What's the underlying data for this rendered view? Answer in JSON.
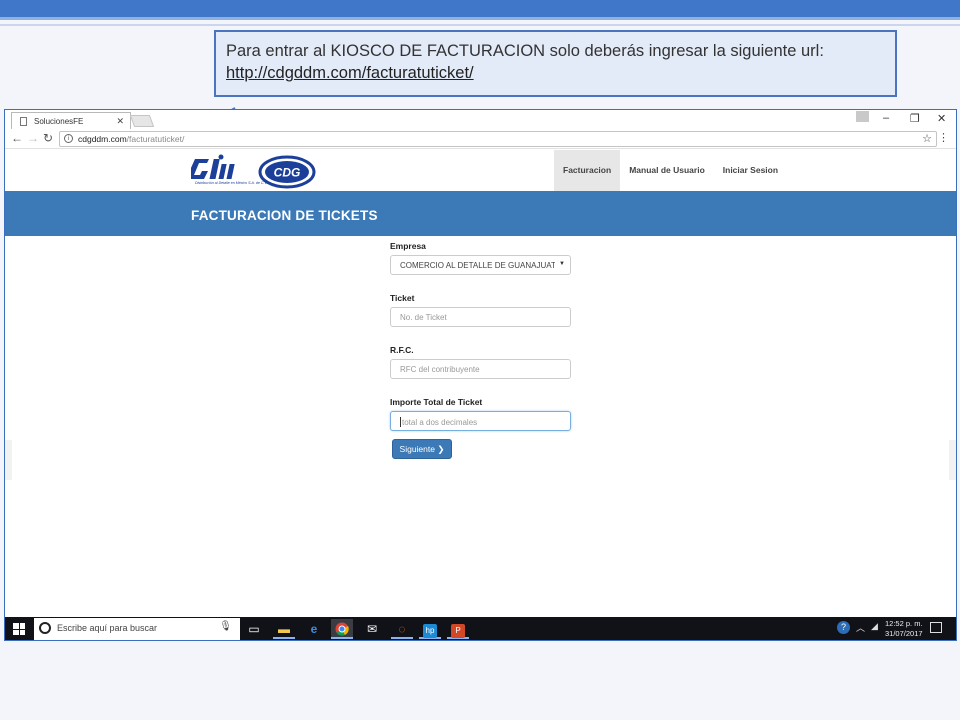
{
  "callout": {
    "line1": "Para entrar al KIOSCO DE FACTURACION solo deberás ingresar la siguiente url:",
    "url": "http://cdgddm.com/facturatuticket/"
  },
  "browser": {
    "tab_title": "SolucionesFE",
    "address_host": "cdgddm.com",
    "address_path": "/facturatuticket/",
    "window_controls": [
      "–",
      "❐",
      "✕"
    ]
  },
  "site": {
    "logo_text": "CDG",
    "logo_sub": "Distribución al Detalle en México S.A. de C.V.",
    "nav": [
      {
        "label": "Facturacion",
        "active": true
      },
      {
        "label": "Manual de Usuario",
        "active": false
      },
      {
        "label": "Iniciar Sesion",
        "active": false
      }
    ],
    "banner_title": "FACTURACION DE TICKETS"
  },
  "form": {
    "empresa_label": "Empresa",
    "empresa_value": "COMERCIO AL DETALLE DE GUANAJUATO",
    "ticket_label": "Ticket",
    "ticket_placeholder": "No. de Ticket",
    "rfc_label": "R.F.C.",
    "rfc_placeholder": "RFC del contribuyente",
    "importe_label": "Importe Total de Ticket",
    "importe_placeholder": "total a dos decimales",
    "submit_label": "Siguiente ❯"
  },
  "taskbar": {
    "search_placeholder": "Escribe aquí para buscar",
    "time": "12:52 p. m.",
    "date": "31/07/2017"
  },
  "colors": {
    "accent": "#3b7ab7",
    "slide_bar": "#4177c8",
    "callout_border": "#4a73c0"
  }
}
